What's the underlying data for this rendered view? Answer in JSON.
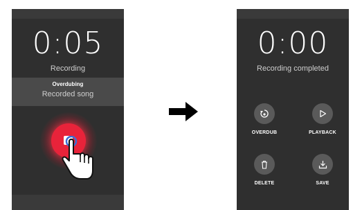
{
  "left_screen": {
    "timer": "0:05",
    "status": "Recording",
    "overdub_title": "Overdubing",
    "song": "Recorded song"
  },
  "right_screen": {
    "timer": "0:00",
    "status": "Recording completed",
    "actions": [
      {
        "label": "OVERDUB",
        "icon": "overdub-icon"
      },
      {
        "label": "PLAYBACK",
        "icon": "play-icon"
      },
      {
        "label": "DELETE",
        "icon": "trash-icon"
      },
      {
        "label": "SAVE",
        "icon": "save-icon"
      }
    ]
  },
  "colors": {
    "record_red": "#e8233a",
    "panel_dark": "#2f2f2f",
    "button_grey": "#5a5a5a"
  }
}
